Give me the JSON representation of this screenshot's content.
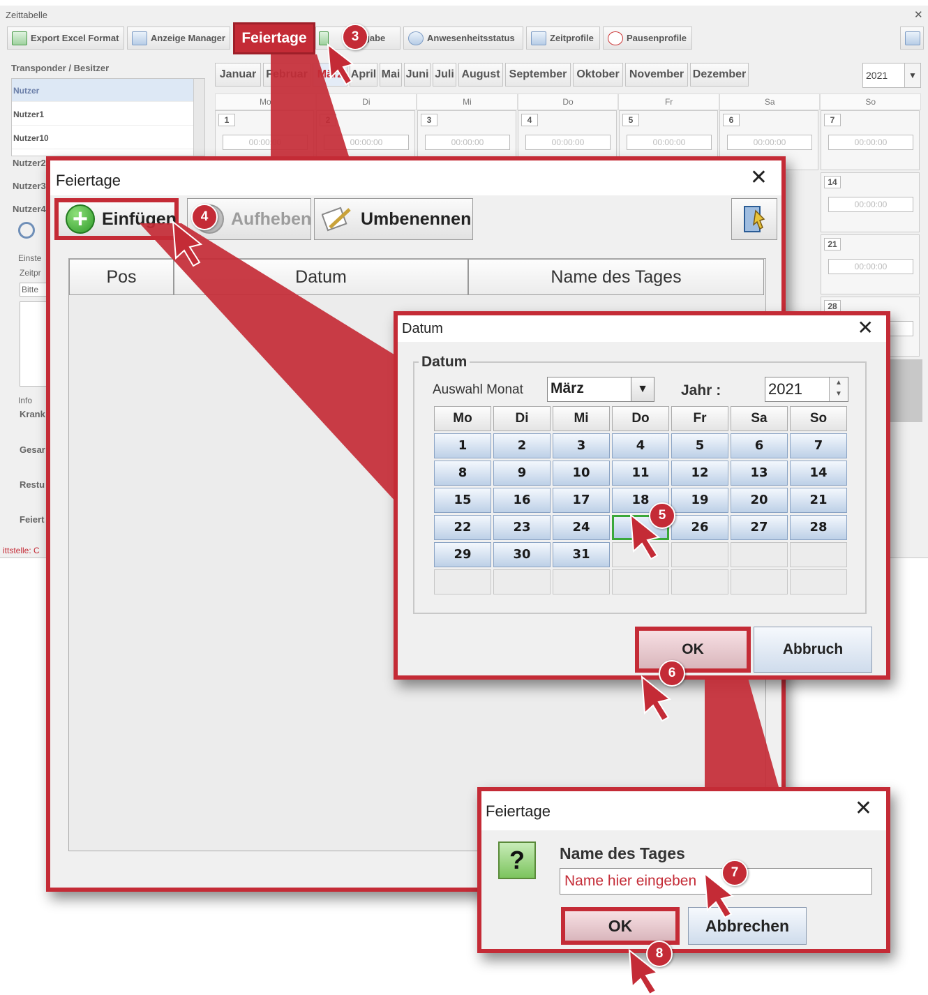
{
  "app": {
    "title": "Zeittabelle",
    "toolbar": [
      {
        "label": "Export Excel Format",
        "icon": "excel-icon"
      },
      {
        "label": "Anzeige Manager",
        "icon": "manager-icon"
      },
      {
        "label": "Feiertage",
        "icon": "holiday-icon"
      },
      {
        "label": "ngabe",
        "icon": "plus-icon"
      },
      {
        "label": "Anwesenheitsstatus",
        "icon": "status-icon"
      },
      {
        "label": "Zeitprofile",
        "icon": "calendar-icon"
      },
      {
        "label": "Pausenprofile",
        "icon": "clock-icon"
      }
    ],
    "sidebar": {
      "title": "Transponder / Besitzer",
      "users": [
        "Nutzer",
        "Nutzer1",
        "Nutzer10",
        "Nutzer2",
        "Nutzer3",
        "Nutzer4"
      ],
      "labels": [
        "Einste",
        "Zeitpr",
        "Bitte",
        "Info",
        "Krank",
        "Gesar",
        "Restu",
        "Feiert"
      ]
    },
    "months": [
      "Januar",
      "Februar",
      "März",
      "April",
      "Mai",
      "Juni",
      "Juli",
      "August",
      "September",
      "Oktober",
      "November",
      "Dezember"
    ],
    "active_month": "März",
    "year": "2021",
    "weekdays": [
      "Mo",
      "Di",
      "Mi",
      "Do",
      "Fr",
      "Sa",
      "So"
    ],
    "day_numbers_visible": [
      "1",
      "2",
      "3",
      "4",
      "5",
      "6",
      "7",
      "14",
      "21",
      "28"
    ],
    "time_placeholder": "00:00:00",
    "status_text": "ittstelle: C"
  },
  "feiertage_dialog": {
    "title": "Feiertage",
    "buttons": {
      "insert": "Einfügen",
      "remove": "Aufheben",
      "rename": "Umbenennen"
    },
    "columns": [
      "Pos",
      "Datum",
      "Name des Tages"
    ]
  },
  "datum_dialog": {
    "title": "Datum",
    "group_label": "Datum",
    "month_label": "Auswahl Monat",
    "month_value": "März",
    "year_label": "Jahr :",
    "year_value": "2021",
    "weekdays": [
      "Mo",
      "Di",
      "Mi",
      "Do",
      "Fr",
      "Sa",
      "So"
    ],
    "days": [
      "1",
      "2",
      "3",
      "4",
      "5",
      "6",
      "7",
      "8",
      "9",
      "10",
      "11",
      "12",
      "13",
      "14",
      "15",
      "16",
      "17",
      "18",
      "19",
      "20",
      "21",
      "22",
      "23",
      "24",
      "25",
      "26",
      "27",
      "28",
      "29",
      "30",
      "31"
    ],
    "selected_day": "25",
    "ok": "OK",
    "cancel": "Abbruch"
  },
  "name_dialog": {
    "title": "Feiertage",
    "question_icon": "?",
    "label": "Name des Tages",
    "input_value": "Name hier eingeben",
    "ok": "OK",
    "cancel": "Abbrechen"
  },
  "steps": [
    "3",
    "4",
    "5",
    "6",
    "7",
    "8"
  ],
  "colors": {
    "accent": "#c42b36",
    "selection": "#3aa83a",
    "calendar_cell": "#bdd0e7"
  }
}
